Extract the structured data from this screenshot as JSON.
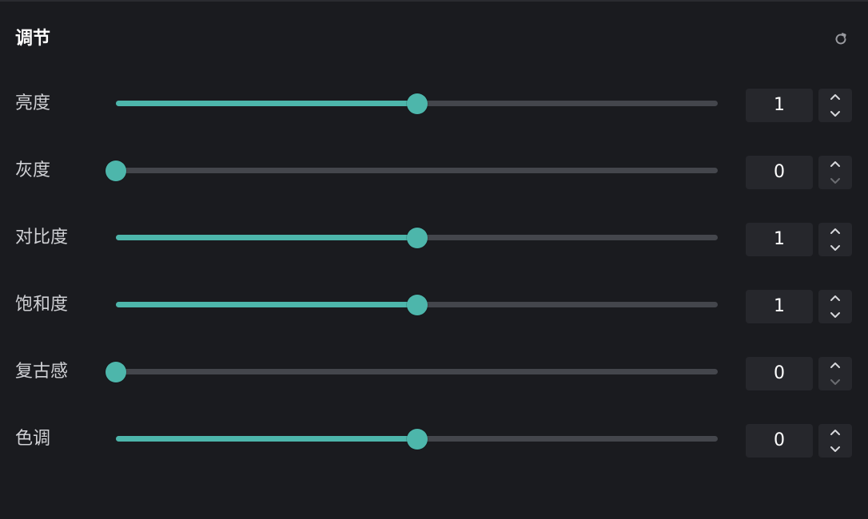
{
  "panel": {
    "title": "调节",
    "reset_icon": "refresh-icon"
  },
  "colors": {
    "background": "#1a1b1f",
    "accent": "#4db6ab",
    "track": "#44464c",
    "input_bg": "#26272c"
  },
  "adjustments": [
    {
      "key": "brightness",
      "label": "亮度",
      "value": "1",
      "level": 0.5,
      "decrement_disabled": false
    },
    {
      "key": "grayscale",
      "label": "灰度",
      "value": "0",
      "level": 0.0,
      "decrement_disabled": true
    },
    {
      "key": "contrast",
      "label": "对比度",
      "value": "1",
      "level": 0.5,
      "decrement_disabled": false
    },
    {
      "key": "saturation",
      "label": "饱和度",
      "value": "1",
      "level": 0.5,
      "decrement_disabled": false
    },
    {
      "key": "sepia",
      "label": "复古感",
      "value": "0",
      "level": 0.0,
      "decrement_disabled": true
    },
    {
      "key": "hue",
      "label": "色调",
      "value": "0",
      "level": 0.5,
      "decrement_disabled": false
    }
  ]
}
